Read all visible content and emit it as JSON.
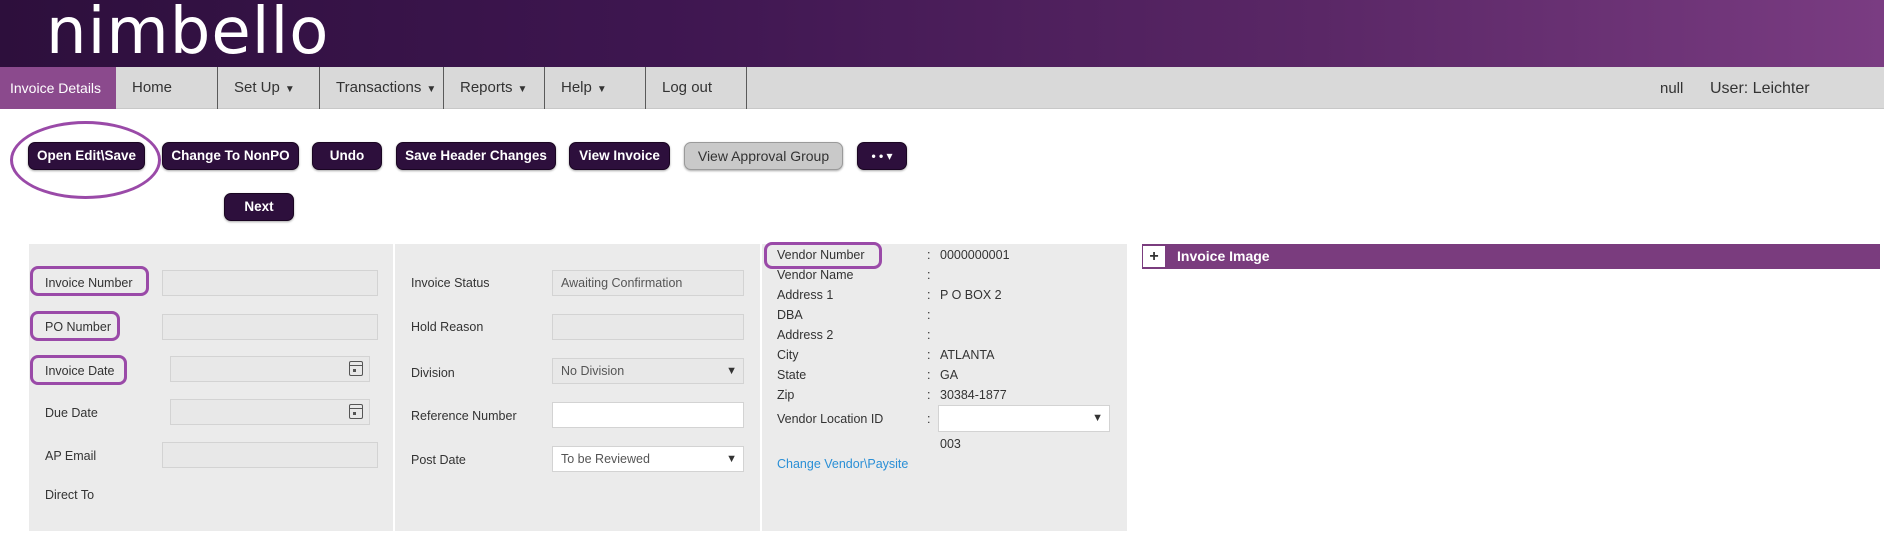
{
  "brand": {
    "logo_text": "nimbello"
  },
  "nav": {
    "items": [
      {
        "label": "Invoice Details"
      },
      {
        "label": "Home"
      },
      {
        "label": "Set Up",
        "caret": "▼"
      },
      {
        "label": "Transactions",
        "caret": "▼"
      },
      {
        "label": "Reports",
        "caret": "▼"
      },
      {
        "label": "Help",
        "caret": "▼"
      },
      {
        "label": "Log out"
      }
    ],
    "null_text": "null",
    "user_text": "User: Leichter"
  },
  "toolbar": {
    "open_edit_save": "Open Edit\\Save",
    "change_to_nonpo": "Change To NonPO",
    "undo": "Undo",
    "save_header_changes": "Save Header Changes",
    "view_invoice": "View Invoice",
    "view_approval_group": "View Approval Group",
    "more": "• • ▾",
    "next": "Next"
  },
  "left_panel": {
    "invoice_number_label": "Invoice Number",
    "po_number_label": "PO Number",
    "invoice_date_label": "Invoice Date",
    "due_date_label": "Due Date",
    "ap_email_label": "AP Email",
    "direct_to_label": "Direct To"
  },
  "middle_panel": {
    "invoice_status_label": "Invoice Status",
    "invoice_status_value": "Awaiting Confirmation",
    "hold_reason_label": "Hold Reason",
    "division_label": "Division",
    "division_value": "No Division",
    "reference_number_label": "Reference Number",
    "post_date_label": "Post Date",
    "post_date_value": "To be Reviewed",
    "select_arrow": "▼"
  },
  "vendor_panel": {
    "colon": ":",
    "vendor_number_label": "Vendor Number",
    "vendor_number_value": "0000000001",
    "vendor_name_label": "Vendor Name",
    "address1_label": "Address 1",
    "address1_value": "P O BOX 2",
    "dba_label": "DBA",
    "address2_label": "Address 2",
    "city_label": "City",
    "city_value": "ATLANTA",
    "state_label": "State",
    "state_value": "GA",
    "zip_label": "Zip",
    "zip_value": "30384-1877",
    "vendor_location_label": "Vendor Location ID",
    "location_code": "003",
    "change_vendor_link": "Change Vendor\\Paysite"
  },
  "invoice_image": {
    "plus": "+",
    "title": "Invoice Image"
  }
}
